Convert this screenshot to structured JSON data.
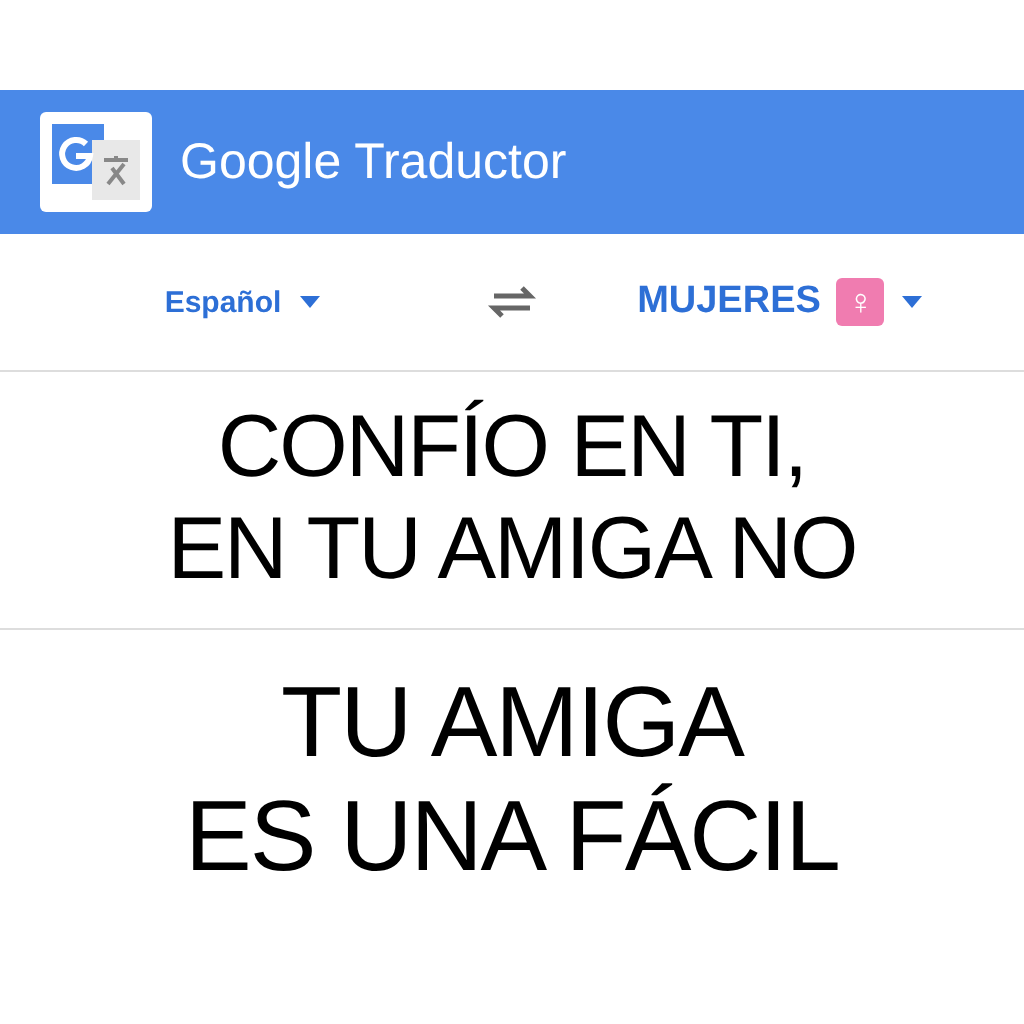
{
  "header": {
    "brand": "Google",
    "product": "Traductor"
  },
  "languages": {
    "source": "Español",
    "target": "MUJERES",
    "target_symbol": "♀"
  },
  "source_text": [
    "CONFÍO EN TI,",
    "EN TU AMIGA NO"
  ],
  "translation": [
    "TU AMIGA",
    "ES UNA FÁCIL"
  ]
}
